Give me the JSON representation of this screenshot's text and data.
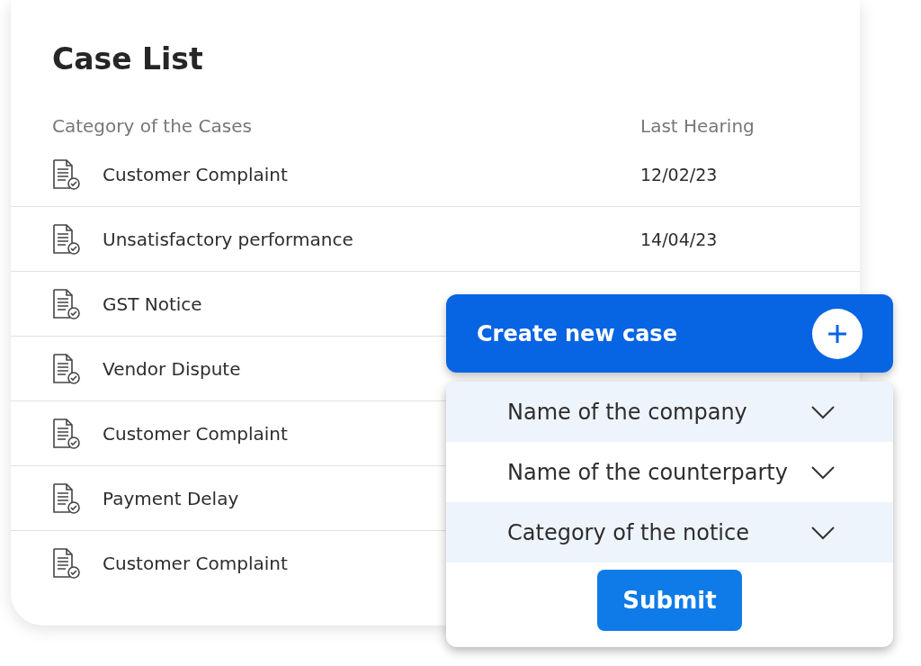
{
  "case_list": {
    "title": "Case List",
    "columns": [
      "Category of the Cases",
      "Last Hearing"
    ],
    "rows": [
      {
        "category": "Customer Complaint",
        "last_hearing": "12/02/23"
      },
      {
        "category": "Unsatisfactory performance",
        "last_hearing": "14/04/23"
      },
      {
        "category": "GST Notice"
      },
      {
        "category": "Vendor Dispute"
      },
      {
        "category": "Customer Complaint"
      },
      {
        "category": "Payment Delay"
      },
      {
        "category": "Customer Complaint"
      }
    ]
  },
  "create_case": {
    "title": "Create new case",
    "fields": [
      {
        "placeholder": "Name of the company"
      },
      {
        "placeholder": "Name of the counterparty"
      },
      {
        "placeholder": "Category of the notice"
      }
    ],
    "submit": "Submit"
  }
}
